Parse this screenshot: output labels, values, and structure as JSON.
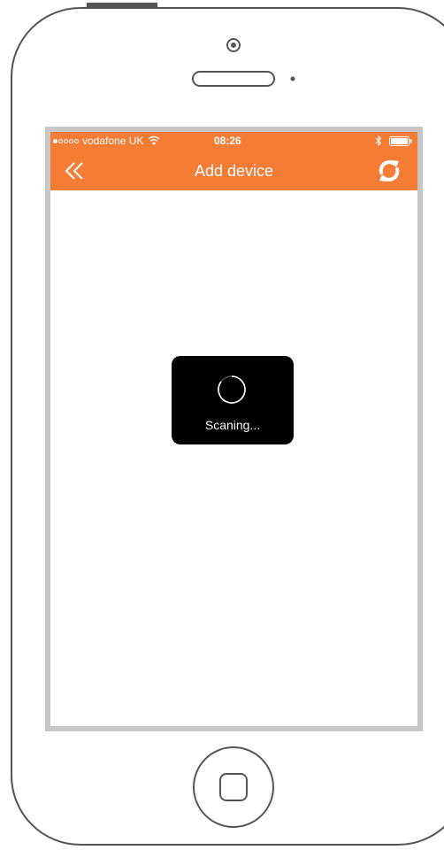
{
  "status_bar": {
    "carrier": "vodafone UK",
    "time": "08:26",
    "signal_bars_filled": 1,
    "signal_bars_total": 5
  },
  "nav": {
    "title": "Add device",
    "back_icon": "double-chevron-left-icon",
    "refresh_icon": "refresh-icon"
  },
  "loading": {
    "label": "Scaning..."
  },
  "colors": {
    "accent": "#f47c34",
    "hud_background": "#000000",
    "screen_border": "#c7c7c7",
    "phone_outline": "#555555"
  }
}
